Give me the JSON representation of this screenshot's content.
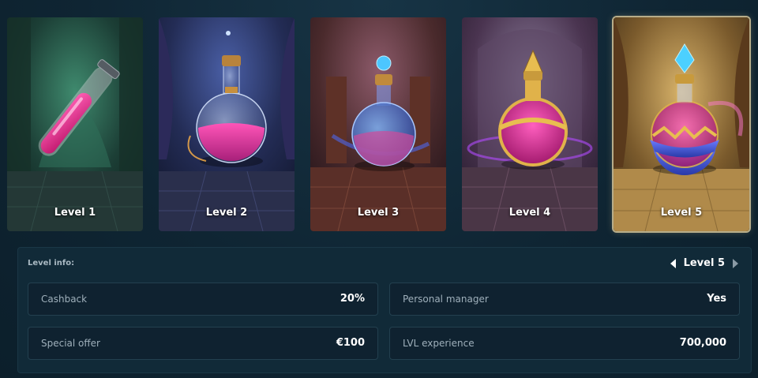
{
  "levels": [
    {
      "label": "Level 1",
      "potion_icon": "test-tube-potion-icon",
      "theme": "#1f4a3c"
    },
    {
      "label": "Level 2",
      "potion_icon": "round-flask-potion-icon",
      "theme": "#2a3460"
    },
    {
      "label": "Level 3",
      "potion_icon": "orb-flask-potion-icon",
      "theme": "#5a2f2a"
    },
    {
      "label": "Level 4",
      "potion_icon": "golden-flask-potion-icon",
      "theme": "#4a2a55"
    },
    {
      "label": "Level 5",
      "potion_icon": "crystal-flask-potion-icon",
      "theme": "#8a6a2a"
    }
  ],
  "selected_level": "Level 5",
  "info": {
    "title": "Level info:",
    "current_level": "Level 5",
    "rows": [
      {
        "key": "Cashback",
        "value": "20%"
      },
      {
        "key": "Personal manager",
        "value": "Yes"
      },
      {
        "key": "Special offer",
        "value": "€100"
      },
      {
        "key": "LVL experience",
        "value": "700,000"
      }
    ]
  },
  "colors": {
    "background": "#0f2533",
    "panel": "#112a38",
    "active_border": "#b7ad8a",
    "potion_pink": "#e0308a"
  }
}
